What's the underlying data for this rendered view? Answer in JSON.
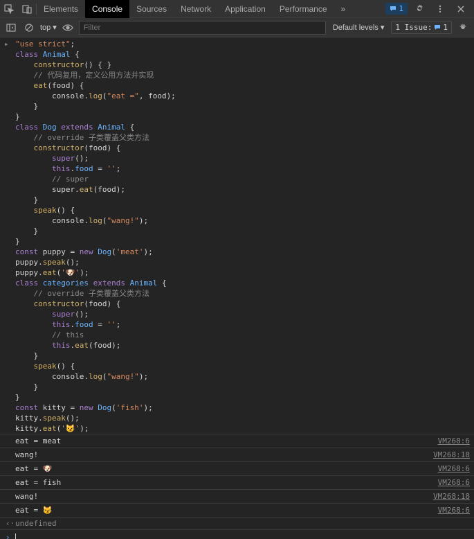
{
  "tabs": {
    "elements": "Elements",
    "console": "Console",
    "sources": "Sources",
    "network": "Network",
    "application": "Application",
    "performance": "Performance"
  },
  "badge_count": "1",
  "toolbar": {
    "context": "top",
    "filter_placeholder": "Filter",
    "levels": "Default levels",
    "issue_label": "1 Issue:",
    "issue_count": "1"
  },
  "code": {
    "l1_a": "\"use strict\"",
    "l1_b": ";",
    "l2_a": "class",
    "l2_b": "Animal",
    "l2_c": "{",
    "l3_a": "constructor",
    "l3_b": "() { }",
    "l4": "// 代码复用，定义公用方法并实现",
    "l5_a": "eat",
    "l5_b": "(food) {",
    "l6_a": "console.",
    "l6_b": "log",
    "l6_c": "(",
    "l6_d": "\"eat =\"",
    "l6_e": ", food);",
    "l7": "}",
    "l8": "}",
    "l9_a": "class",
    "l9_b": "Dog",
    "l9_c": "extends",
    "l9_d": "Animal",
    "l9_e": "{",
    "l10": "// override 子类覆盖父类方法",
    "l11_a": "constructor",
    "l11_b": "(food) {",
    "l12_a": "super",
    "l12_b": "();",
    "l13_a": "this",
    "l13_b": ".",
    "l13_c": "food",
    "l13_d": " = ",
    "l13_e": "''",
    "l13_f": ";",
    "l14": "// super",
    "l15_a": "super.",
    "l15_b": "eat",
    "l15_c": "(food);",
    "l16": "}",
    "l17_a": "speak",
    "l17_b": "() {",
    "l18_a": "console.",
    "l18_b": "log",
    "l18_c": "(",
    "l18_d": "\"wang!\"",
    "l18_e": ");",
    "l19": "}",
    "l20": "}",
    "l21_a": "const",
    "l21_b": "puppy = ",
    "l21_c": "new",
    "l21_d": "Dog",
    "l21_e": "(",
    "l21_f": "'meat'",
    "l21_g": ");",
    "l22_a": "puppy.",
    "l22_b": "speak",
    "l22_c": "();",
    "l23_a": "puppy.",
    "l23_b": "eat",
    "l23_c": "(",
    "l23_d": "'🐶'",
    "l23_e": ");",
    "l24_a": "class",
    "l24_b": "categories",
    "l24_c": "extends",
    "l24_d": "Animal",
    "l24_e": "{",
    "l25": "// override 子类覆盖父类方法",
    "l26_a": "constructor",
    "l26_b": "(food) {",
    "l27_a": "super",
    "l27_b": "();",
    "l28_a": "this",
    "l28_b": ".",
    "l28_c": "food",
    "l28_d": " = ",
    "l28_e": "''",
    "l28_f": ";",
    "l29": "// this",
    "l30_a": "this",
    "l30_b": ".",
    "l30_c": "eat",
    "l30_d": "(food);",
    "l31": "}",
    "l32_a": "speak",
    "l32_b": "() {",
    "l33_a": "console.",
    "l33_b": "log",
    "l33_c": "(",
    "l33_d": "\"wang!\"",
    "l33_e": ");",
    "l34": "}",
    "l35": "}",
    "l36_a": "const",
    "l36_b": "kitty = ",
    "l36_c": "new",
    "l36_d": "Dog",
    "l36_e": "(",
    "l36_f": "'fish'",
    "l36_g": ");",
    "l37_a": "kitty.",
    "l37_b": "speak",
    "l37_c": "();",
    "l38_a": "kitty.",
    "l38_b": "eat",
    "l38_c": "(",
    "l38_d": "'😼'",
    "l38_e": ");"
  },
  "logs": [
    {
      "msg": "eat = meat",
      "src": "VM268:6"
    },
    {
      "msg": "wang!",
      "src": "VM268:18"
    },
    {
      "msg": "eat = 🐶",
      "src": "VM268:6"
    },
    {
      "msg": "eat = fish",
      "src": "VM268:6"
    },
    {
      "msg": "wang!",
      "src": "VM268:18"
    },
    {
      "msg": "eat = 😼",
      "src": "VM268:6"
    }
  ],
  "return_value": "undefined"
}
